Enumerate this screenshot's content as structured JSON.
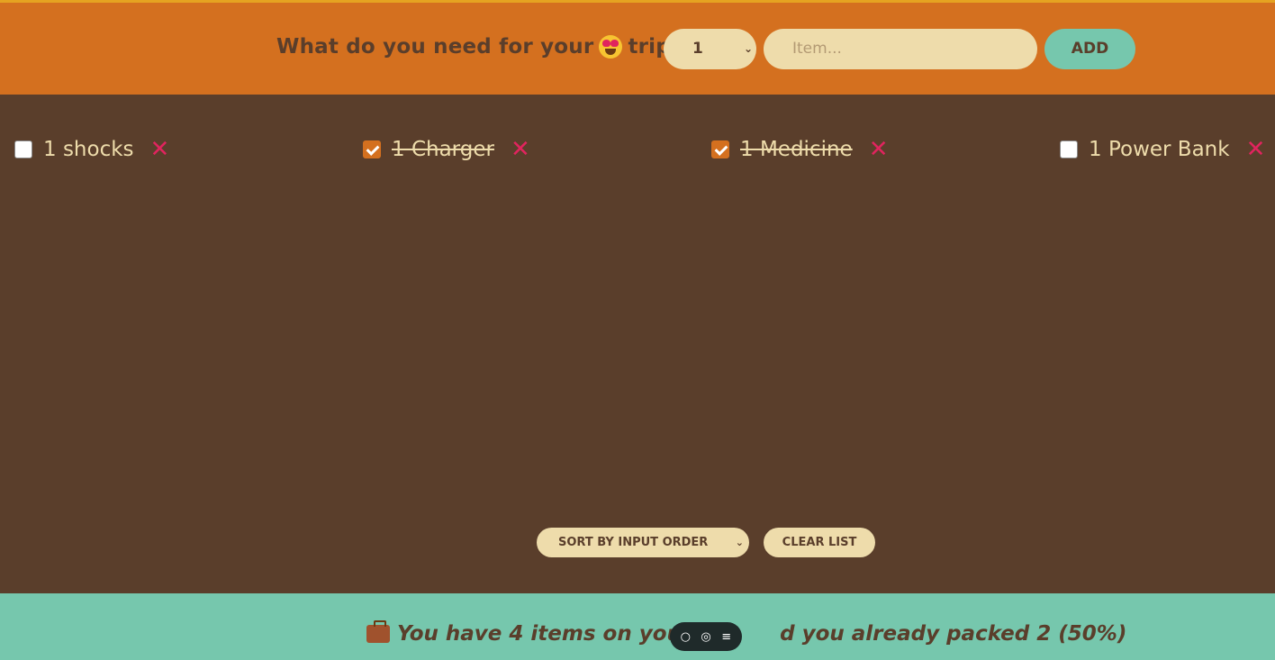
{
  "header": {
    "question_prefix": "What do you need for your",
    "emoji": "heart-eyes-emoji",
    "question_suffix": "trip?",
    "quantity_value": "1",
    "item_placeholder": "Item...",
    "add_label": "ADD"
  },
  "items": [
    {
      "quantity": 1,
      "label": "1 shocks",
      "packed": false
    },
    {
      "quantity": 1,
      "label": "1 Charger",
      "packed": true
    },
    {
      "quantity": 1,
      "label": "1 Medicine",
      "packed": true
    },
    {
      "quantity": 1,
      "label": "1 Power Bank",
      "packed": false
    }
  ],
  "actions": {
    "sort_value": "SORT BY INPUT ORDER",
    "clear_label": "CLEAR LIST"
  },
  "footer": {
    "stats_before": "You have 4 items on your l",
    "stats_after": "d you already packed 2 (50%)"
  },
  "colors": {
    "header_bg": "#d4701f",
    "list_bg": "#5a3e2b",
    "footer_bg": "#76c7ad",
    "accent_text": "#eedcab",
    "delete": "#e0245e"
  }
}
